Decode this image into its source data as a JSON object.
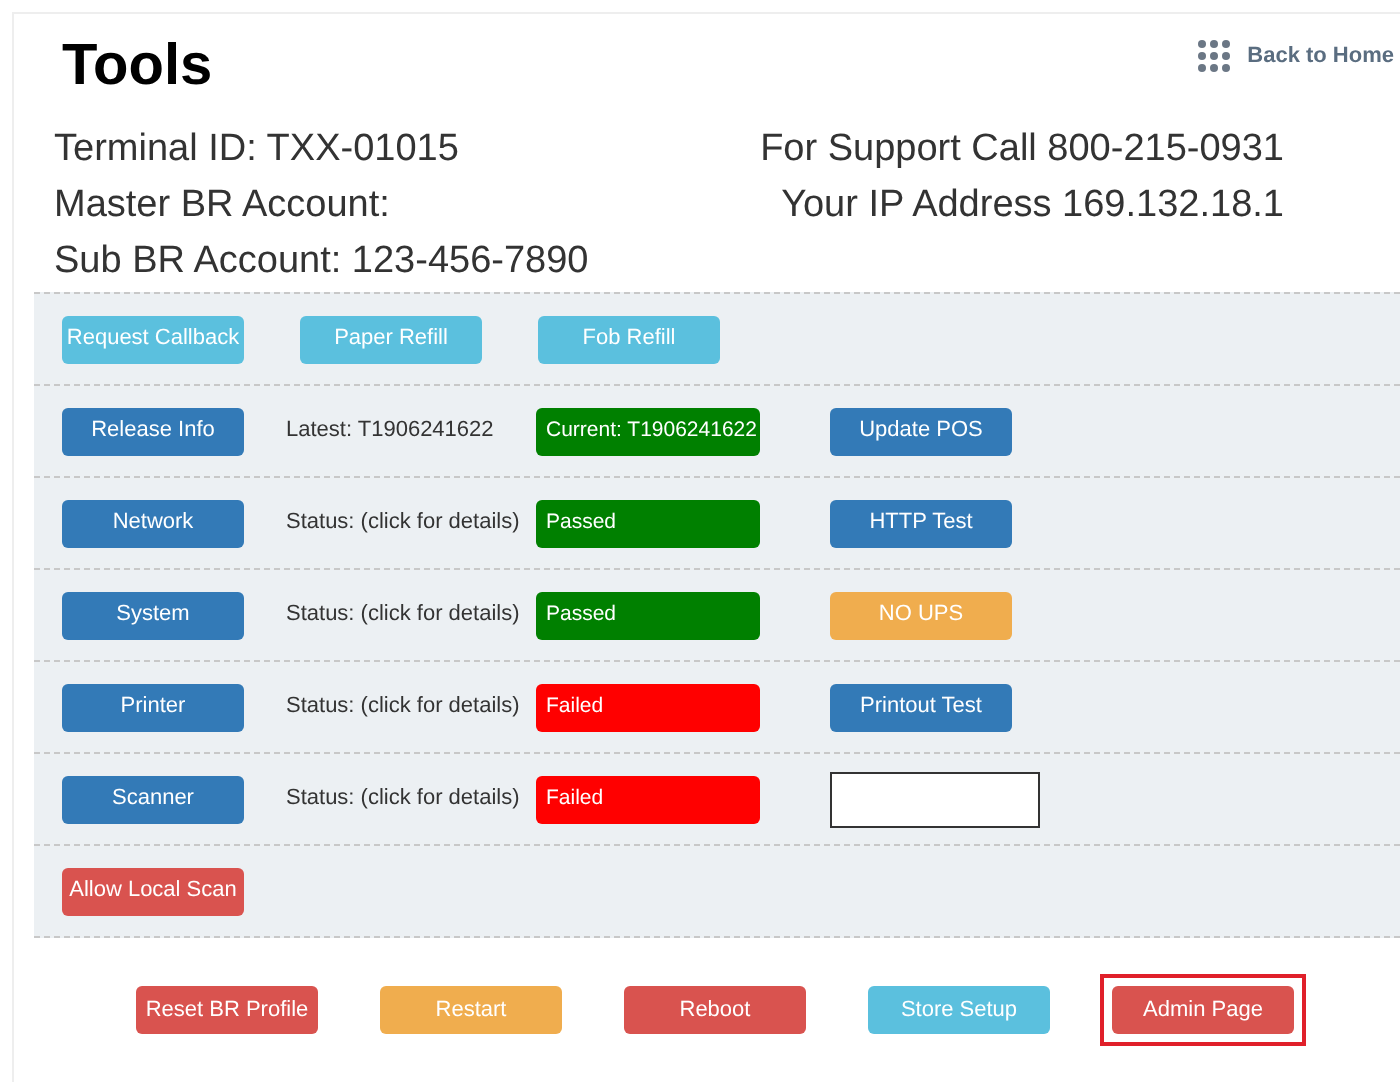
{
  "title": "Tools",
  "back_link": "Back to Home",
  "info_left": [
    "Terminal ID: TXX-01015",
    "Master BR Account:",
    "Sub BR Account: 123-456-7890"
  ],
  "info_right": [
    "For Support Call 800-215-0931",
    "Your IP Address 169.132.18.1"
  ],
  "request_buttons": [
    {
      "label": "Request Callback",
      "kind": "info"
    },
    {
      "label": "Paper Refill",
      "kind": "info"
    },
    {
      "label": "Fob Refill",
      "kind": "info"
    }
  ],
  "rows": [
    {
      "button": {
        "label": "Release Info",
        "kind": "primary"
      },
      "status": "Latest: T1906241622",
      "badge": {
        "text": "Current: T1906241622",
        "kind": "passed"
      },
      "action": {
        "kind": "primary_button",
        "label": "Update POS"
      }
    },
    {
      "button": {
        "label": "Network",
        "kind": "primary"
      },
      "status": "Status: (click for details)",
      "badge": {
        "text": "Passed",
        "kind": "passed"
      },
      "action": {
        "kind": "primary_button",
        "label": "HTTP Test"
      }
    },
    {
      "button": {
        "label": "System",
        "kind": "primary"
      },
      "status": "Status: (click for details)",
      "badge": {
        "text": "Passed",
        "kind": "passed"
      },
      "action": {
        "kind": "warning_button",
        "label": "NO UPS"
      }
    },
    {
      "button": {
        "label": "Printer",
        "kind": "primary"
      },
      "status": "Status: (click for details)",
      "badge": {
        "text": "Failed",
        "kind": "failed"
      },
      "action": {
        "kind": "primary_button",
        "label": "Printout Test"
      }
    },
    {
      "button": {
        "label": "Scanner",
        "kind": "primary"
      },
      "status": "Status: (click for details)",
      "badge": {
        "text": "Failed",
        "kind": "failed"
      },
      "action": {
        "kind": "input"
      }
    }
  ],
  "extra_button": {
    "label": "Allow Local Scan",
    "kind": "danger"
  },
  "footer_buttons": [
    {
      "label": "Reset BR Profile",
      "kind": "danger",
      "highlighted": false
    },
    {
      "label": "Restart",
      "kind": "warning",
      "highlighted": false
    },
    {
      "label": "Reboot",
      "kind": "danger",
      "highlighted": false
    },
    {
      "label": "Store Setup",
      "kind": "info",
      "highlighted": false
    },
    {
      "label": "Admin Page",
      "kind": "danger",
      "highlighted": true
    }
  ]
}
